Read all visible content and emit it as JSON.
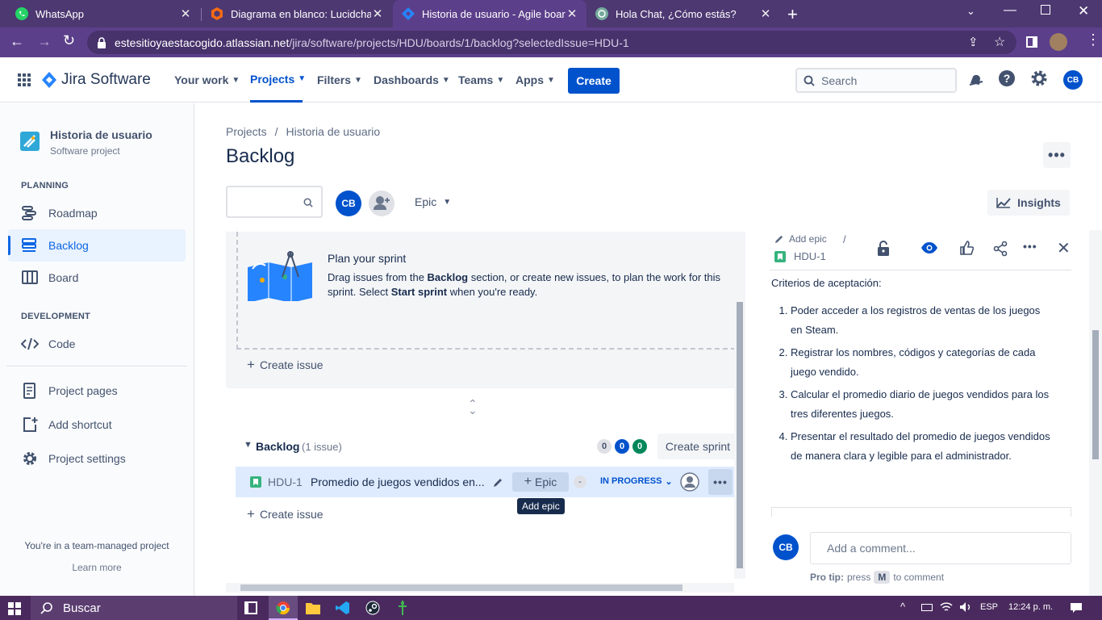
{
  "browser": {
    "tabs": [
      {
        "title": "WhatsApp",
        "icon": "whatsapp-icon"
      },
      {
        "title": "Diagrama en blanco: Lucidchart",
        "icon": "lucidchart-icon"
      },
      {
        "title": "Historia de usuario - Agile board",
        "icon": "jira-icon",
        "active": true
      },
      {
        "title": "Hola Chat, ¿Cómo estás?",
        "icon": "chatgpt-icon"
      }
    ],
    "url_host": "estesitioyaestacogido.atlassian.net",
    "url_path": "/jira/software/projects/HDU/boards/1/backlog?selectedIssue=HDU-1"
  },
  "header": {
    "product": "Jira Software",
    "nav": [
      "Your work",
      "Projects",
      "Filters",
      "Dashboards",
      "Teams",
      "Apps"
    ],
    "create": "Create",
    "search_placeholder": "Search",
    "avatar": "CB"
  },
  "sidebar": {
    "project_name": "Historia de usuario",
    "project_type": "Software project",
    "planning_heading": "PLANNING",
    "planning_items": [
      "Roadmap",
      "Backlog",
      "Board"
    ],
    "development_heading": "DEVELOPMENT",
    "dev_items": [
      "Code"
    ],
    "extra_items": [
      "Project pages",
      "Add shortcut",
      "Project settings"
    ],
    "footer_text": "You're in a team-managed project",
    "footer_link": "Learn more"
  },
  "main": {
    "breadcrumb_root": "Projects",
    "breadcrumb_sep": "/",
    "breadcrumb_project": "Historia de usuario",
    "title": "Backlog",
    "avatar": "CB",
    "epic_filter": "Epic",
    "insights": "Insights",
    "sprint_empty_title": "Plan your sprint",
    "sprint_empty_p1": "Drag issues from the ",
    "sprint_empty_b1": "Backlog",
    "sprint_empty_p2": " section, or create new issues, to plan the work for this sprint. Select ",
    "sprint_empty_b2": "Start sprint",
    "sprint_empty_p3": " when you're ready.",
    "create_issue": "Create issue",
    "backlog_label": "Backlog",
    "backlog_count": "(1 issue)",
    "counts": [
      "0",
      "0",
      "0"
    ],
    "create_sprint": "Create sprint",
    "issue": {
      "key": "HDU-1",
      "summary": "Promedio de juegos vendidos en...",
      "epic_btn": "Epic",
      "points": "-",
      "status": "IN PROGRESS"
    },
    "tooltip": "Add epic",
    "create_issue_2": "Create issue"
  },
  "detail": {
    "add_epic": "Add epic",
    "sep": "/",
    "issue_key": "HDU-1",
    "criteria_heading": "Criterios de aceptación:",
    "criteria": [
      "Poder acceder a los registros de ventas de los juegos en Steam.",
      "Registrar los nombres, códigos y categorías de cada juego vendido.",
      "Calcular el promedio diario de juegos vendidos para los tres diferentes juegos.",
      "Presentar el resultado del promedio de juegos vendidos de manera clara y legible para el administrador."
    ],
    "avatar": "CB",
    "comment_placeholder": "Add a comment...",
    "protip_label": "Pro tip:",
    "protip_press": "press",
    "protip_key": "M",
    "protip_rest": "to comment"
  },
  "taskbar": {
    "search": "Buscar",
    "lang": "ESP",
    "time": "12:24 p. m."
  },
  "colors": {
    "browser_frame": "#5c3f8a",
    "jira_blue": "#0052cc",
    "status_blue": "#0052cc",
    "story_green": "#36b37e"
  }
}
